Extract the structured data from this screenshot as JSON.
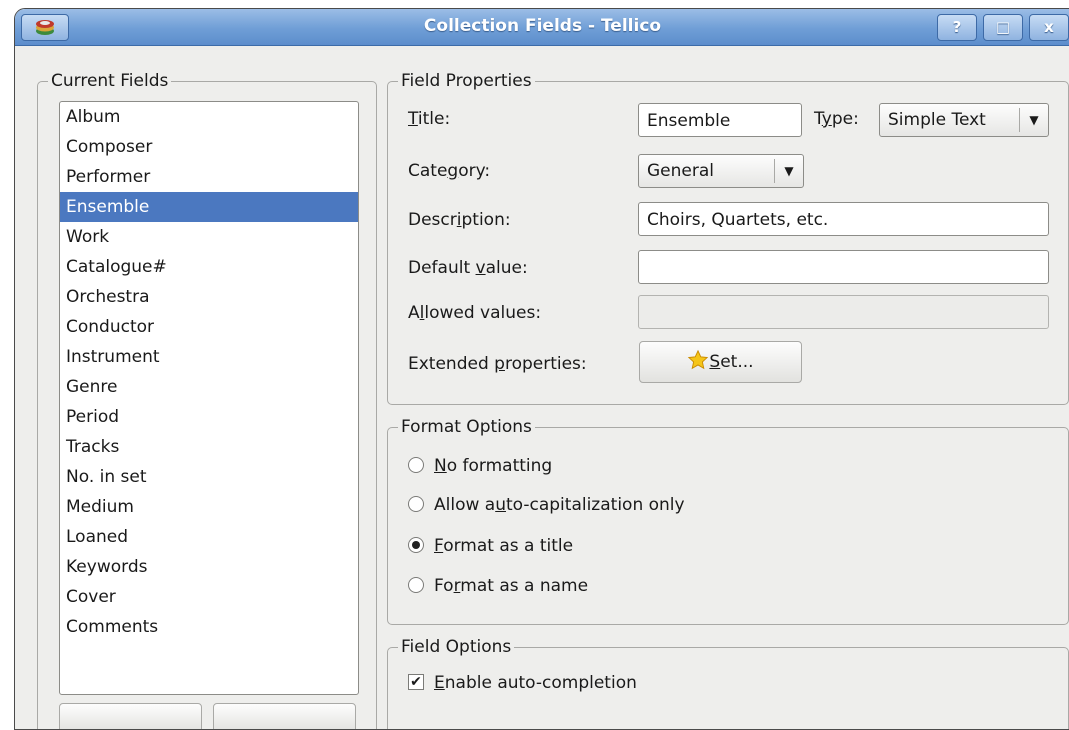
{
  "window": {
    "title": "Collection Fields - Tellico",
    "help_label": "?",
    "maximize_label": "□",
    "close_label": "x"
  },
  "current_fields": {
    "title": "Current Fields",
    "items": [
      "Album",
      "Composer",
      "Performer",
      "Ensemble",
      "Work",
      "Catalogue#",
      "Orchestra",
      "Conductor",
      "Instrument",
      "Genre",
      "Period",
      "Tracks",
      "No. in set",
      "Medium",
      "Loaned",
      "Keywords",
      "Cover",
      "Comments"
    ],
    "selected": "Ensemble"
  },
  "field_properties": {
    "title": "Field Properties",
    "title_label_u": "T",
    "title_label_rest": "itle:",
    "title_value": "Ensemble",
    "type_label_pre": "T",
    "type_label_u": "y",
    "type_label_rest": "pe:",
    "type_value": "Simple Text",
    "category_label_pre": "Cate",
    "category_label_u": "g",
    "category_label_rest": "ory:",
    "category_value": "General",
    "description_label_pre": "Descr",
    "description_label_u": "i",
    "description_label_rest": "ption:",
    "description_value": "Choirs, Quartets, etc.",
    "default_label_pre": "Default ",
    "default_label_u": "v",
    "default_label_rest": "alue:",
    "default_value": "",
    "allowed_label_pre": "A",
    "allowed_label_u": "l",
    "allowed_label_rest": "lowed values:",
    "allowed_value": "",
    "extended_label_pre": "Extended ",
    "extended_label_u": "p",
    "extended_label_rest": "roperties:",
    "set_button_u": "S",
    "set_button_rest": "et..."
  },
  "format_options": {
    "title": "Format Options",
    "options": [
      {
        "pre": "",
        "u": "N",
        "rest": "o formatting",
        "selected": false
      },
      {
        "pre": "Allow a",
        "u": "u",
        "rest": "to-capitalization only",
        "selected": false
      },
      {
        "pre": "",
        "u": "F",
        "rest": "ormat as a title",
        "selected": true
      },
      {
        "pre": "Fo",
        "u": "r",
        "rest": "mat as a name",
        "selected": false
      }
    ]
  },
  "field_options": {
    "title": "Field Options",
    "autocomplete_u": "E",
    "autocomplete_rest": "nable auto-completion",
    "autocomplete_checked": true
  },
  "colors": {
    "selection": "#4b78c0",
    "titlebar": "#6f9ed6"
  }
}
